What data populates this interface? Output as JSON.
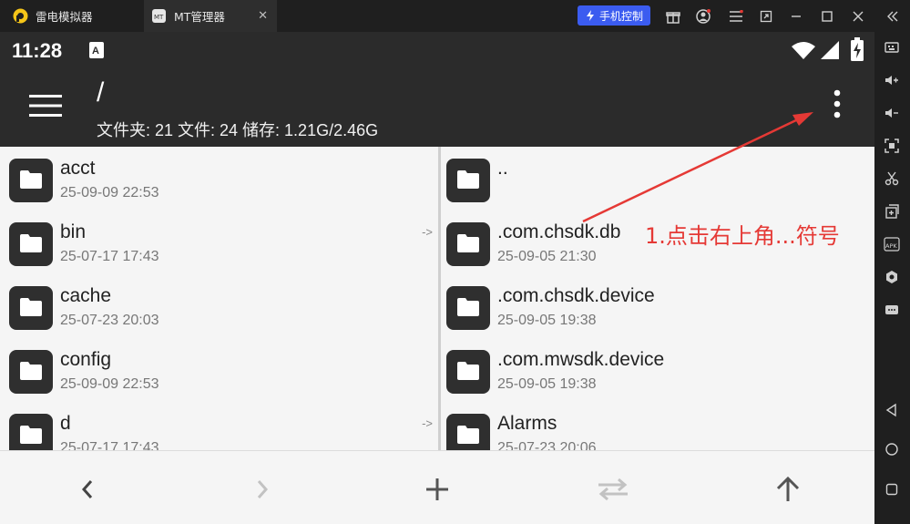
{
  "window": {
    "tabs": [
      {
        "label": "雷电模拟器",
        "icon": "ldplayer-logo-icon"
      },
      {
        "label": "MT管理器",
        "icon": "mt-app-icon"
      }
    ],
    "phone_control_label": "手机控制",
    "accent": "#3b5cf0"
  },
  "status_bar": {
    "time": "11:28"
  },
  "app_bar": {
    "path": "/",
    "summary": "文件夹: 21  文件: 24  储存: 1.21G/2.46G"
  },
  "left_pane": {
    "items": [
      {
        "name": "acct",
        "date": "25-09-09 22:53",
        "link": ""
      },
      {
        "name": "bin",
        "date": "25-07-17 17:43",
        "link": "->"
      },
      {
        "name": "cache",
        "date": "25-07-23 20:03",
        "link": ""
      },
      {
        "name": "config",
        "date": "25-09-09 22:53",
        "link": ""
      },
      {
        "name": "d",
        "date": "25-07-17 17:43",
        "link": "->"
      }
    ]
  },
  "right_pane": {
    "items": [
      {
        "name": "..",
        "date": ""
      },
      {
        "name": ".com.chsdk.db",
        "date": "25-09-05 21:30"
      },
      {
        "name": ".com.chsdk.device",
        "date": "25-09-05 19:38"
      },
      {
        "name": ".com.mwsdk.device",
        "date": "25-09-05 19:38"
      },
      {
        "name": "Alarms",
        "date": "25-07-23 20:06"
      }
    ]
  },
  "annotation": {
    "text": "1.点击右上角...符号",
    "color": "#e53935"
  }
}
